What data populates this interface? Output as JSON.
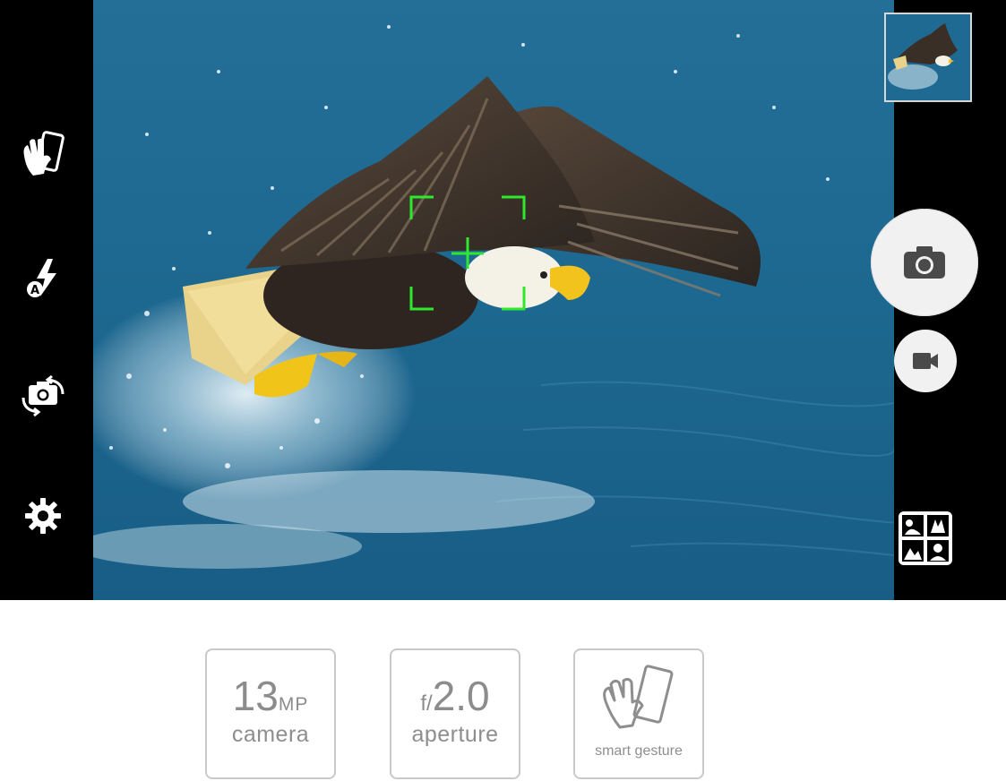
{
  "camera": {
    "left_controls": [
      {
        "icon": "hand-gesture-icon"
      },
      {
        "icon": "auto-flash-icon"
      },
      {
        "icon": "switch-camera-icon"
      },
      {
        "icon": "settings-gear-icon"
      }
    ],
    "right_controls": {
      "thumbnail_icon": "last-photo-thumbnail",
      "shutter_icon": "camera-icon",
      "video_icon": "video-camera-icon",
      "modes_icon": "scene-modes-icon"
    },
    "viewfinder": {
      "focus_color": "#2ee82e",
      "water_color": "#1f6d96"
    }
  },
  "features": [
    {
      "big": "13",
      "unit": "MP",
      "label": "camera"
    },
    {
      "prefix": "f/",
      "big": "2.0",
      "label": "aperture"
    },
    {
      "label": "smart gesture"
    }
  ],
  "colors": {
    "feature_text": "#8e8e8e",
    "feature_border": "#c9c9c9",
    "bar": "#000000"
  }
}
